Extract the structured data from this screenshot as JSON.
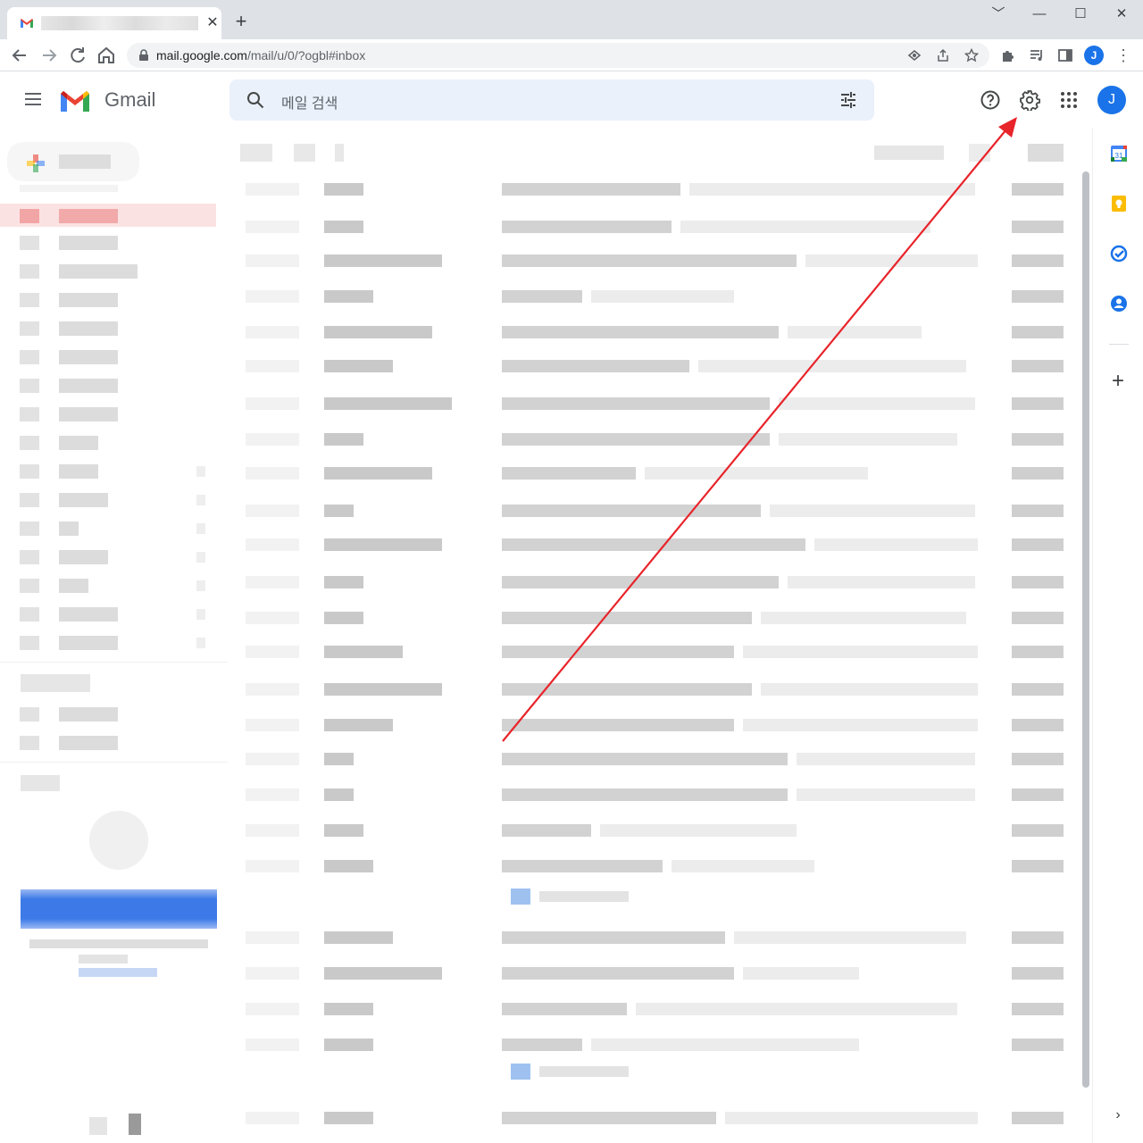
{
  "browser": {
    "tab_close": "✕",
    "new_tab": "+",
    "window_controls": [
      "﹀",
      "—",
      "☐",
      "✕"
    ],
    "url_host": "mail.google.com",
    "url_path": "/mail/u/0/?ogbl#inbox",
    "profile_initial": "J",
    "menu_glyph": "⋮"
  },
  "gmail": {
    "product_name": "Gmail",
    "search_placeholder": "메일 검색",
    "account_initial": "J",
    "header_icons": [
      "help-icon",
      "settings-icon",
      "apps-grid-icon"
    ]
  },
  "side_panel": {
    "items": [
      "calendar-icon",
      "keep-icon",
      "tasks-icon",
      "contacts-icon"
    ],
    "calendar_day": "31",
    "add_glyph": "+",
    "collapse_glyph": "›"
  },
  "colors": {
    "gmail_red": "#ea4335",
    "gmail_blue": "#4285f4",
    "gmail_green": "#34a853",
    "gmail_yellow": "#fbbc04",
    "accent_blue": "#1a73e8",
    "annotation_arrow": "#e8242b",
    "search_bg": "#eaf1fb"
  },
  "annotation": {
    "type": "arrow",
    "points_to": "settings-icon"
  }
}
